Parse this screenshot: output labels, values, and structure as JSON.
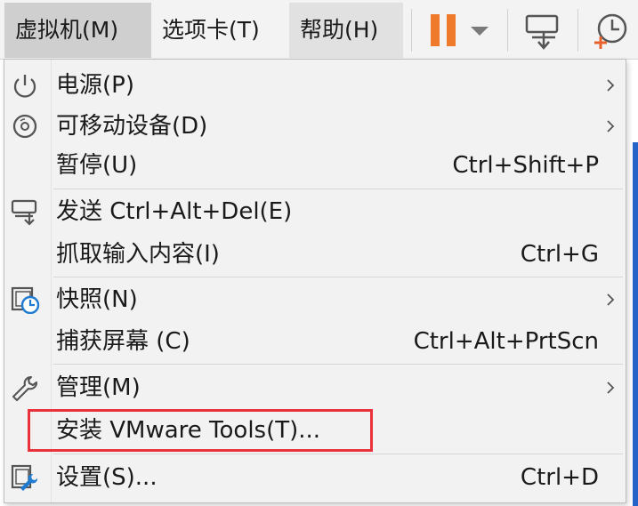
{
  "menubar": {
    "items": [
      {
        "label": "虚拟机(M)",
        "state": "active"
      },
      {
        "label": "选项卡(T)",
        "state": "normal"
      },
      {
        "label": "帮助(H)",
        "state": "hover"
      }
    ]
  },
  "toolbar": {
    "buttons": [
      {
        "icon": "pause-icon",
        "color": "#f07a2c"
      },
      {
        "icon": "send-ctrl-alt-del-icon"
      },
      {
        "icon": "snapshot-clock-icon",
        "accent": "#e8632c"
      }
    ]
  },
  "menu": {
    "items": [
      {
        "icon": "power-icon",
        "label": "电源(P)",
        "shortcut": "",
        "submenu": true
      },
      {
        "icon": "removable-device-icon",
        "label": "可移动设备(D)",
        "shortcut": "",
        "submenu": true
      },
      {
        "icon": "",
        "label": "暂停(U)",
        "shortcut": "Ctrl+Shift+P",
        "submenu": false
      },
      {
        "icon": "send-keys-icon",
        "label": "发送 Ctrl+Alt+Del(E)",
        "shortcut": "",
        "submenu": false
      },
      {
        "icon": "",
        "label": "抓取输入内容(I)",
        "shortcut": "Ctrl+G",
        "submenu": false
      },
      {
        "icon": "snapshot-icon",
        "label": "快照(N)",
        "shortcut": "",
        "submenu": true
      },
      {
        "icon": "",
        "label": "捕获屏幕 (C)",
        "shortcut": "Ctrl+Alt+PrtScn",
        "submenu": false
      },
      {
        "icon": "wrench-icon",
        "label": "管理(M)",
        "shortcut": "",
        "submenu": true
      },
      {
        "icon": "",
        "label": "安装 VMware Tools(T)...",
        "shortcut": "",
        "submenu": false,
        "highlighted": true
      },
      {
        "icon": "settings-icon",
        "label": "设置(S)...",
        "shortcut": "Ctrl+D",
        "submenu": false
      }
    ]
  },
  "colors": {
    "highlight_border": "#e8323c",
    "menu_background": "#f2f2f2",
    "accent_blue": "#2563c9"
  }
}
